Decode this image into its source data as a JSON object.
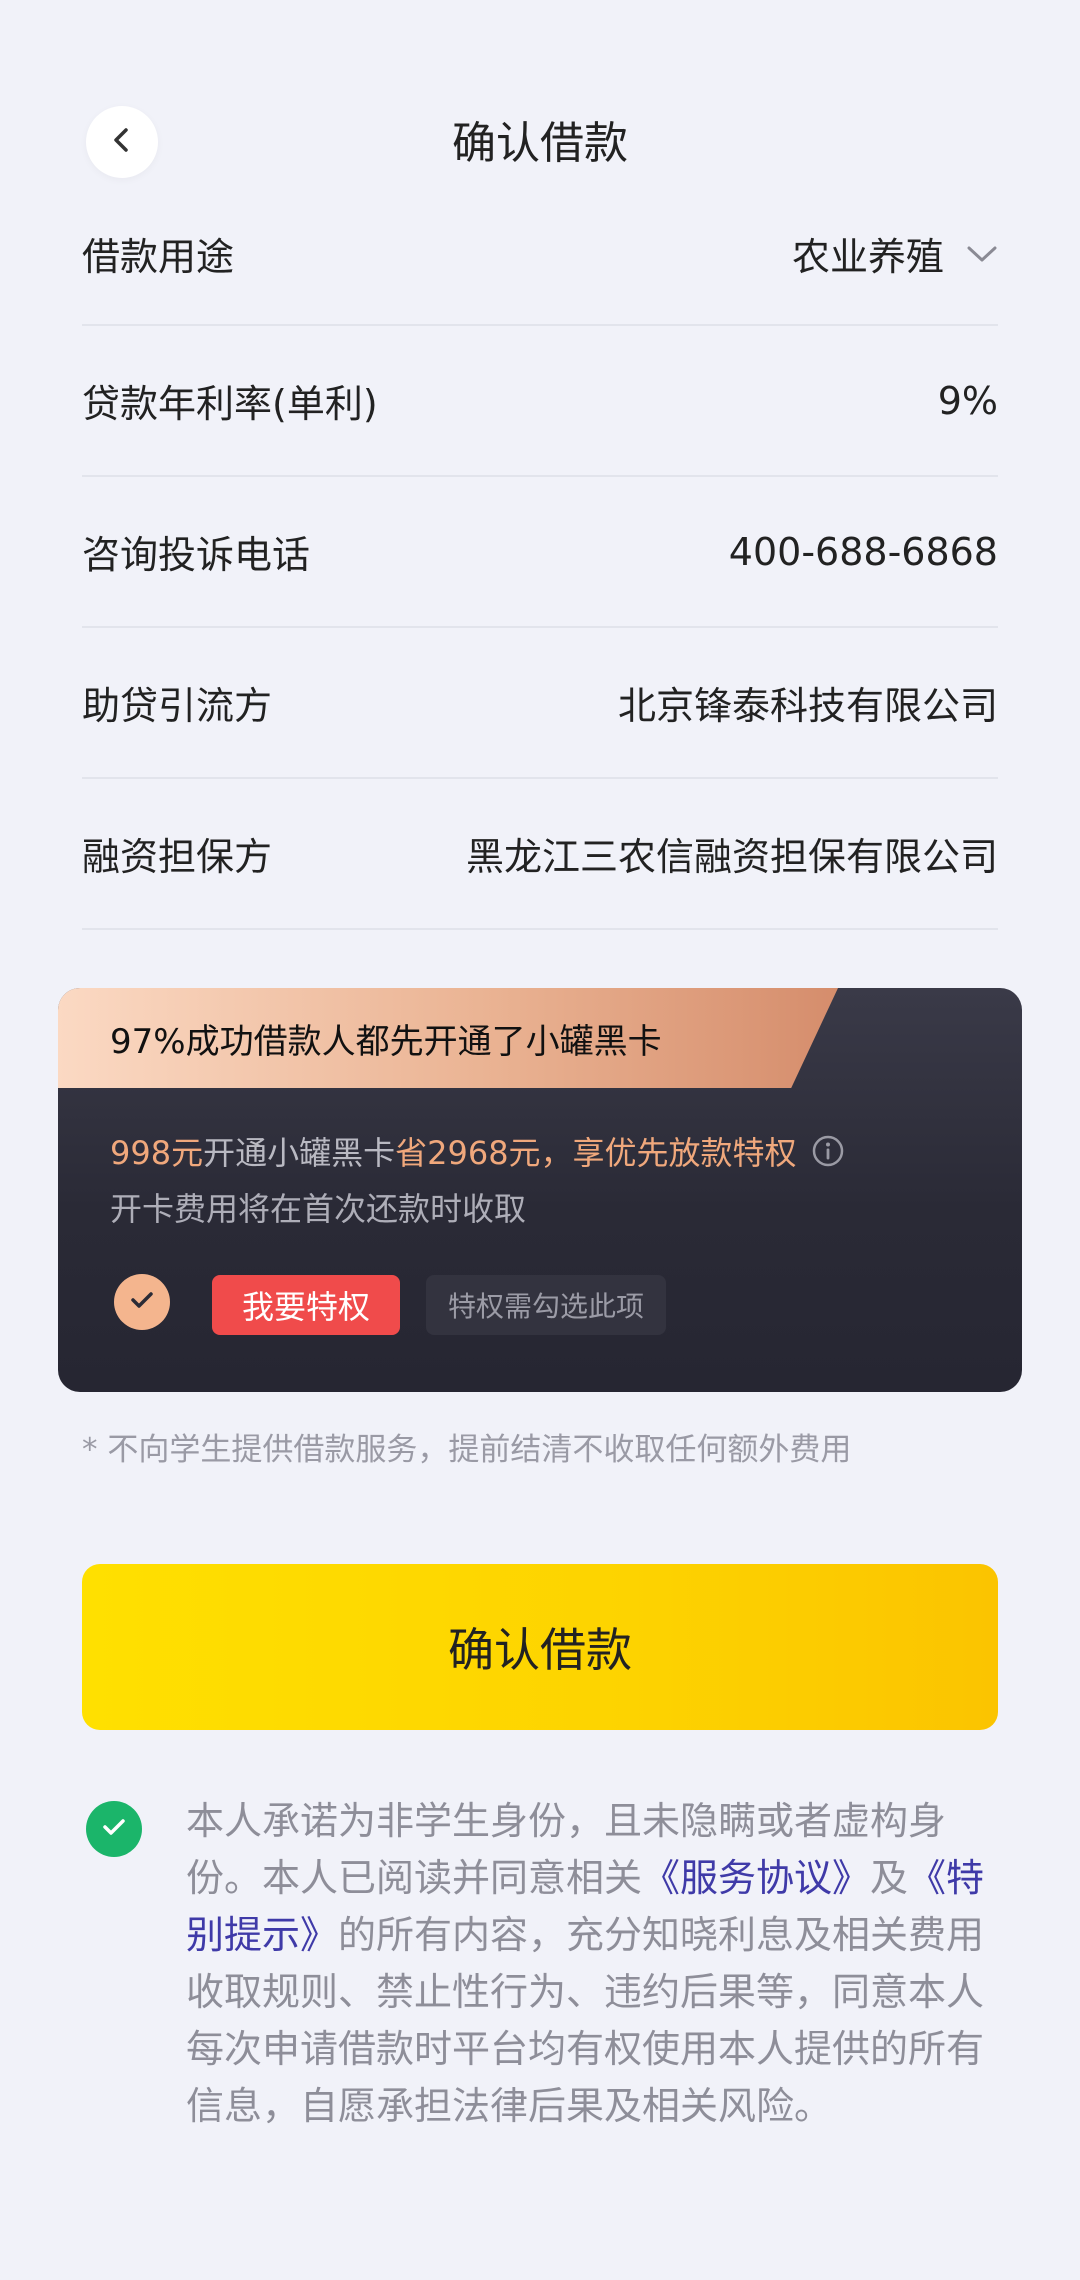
{
  "header": {
    "title": "确认借款"
  },
  "rows": [
    {
      "label": "借款用途",
      "value": "农业养殖"
    },
    {
      "label": "贷款年利率(单利)",
      "value": "9%"
    },
    {
      "label": "咨询投诉电话",
      "value": "400-688-6868"
    },
    {
      "label": "助贷引流方",
      "value": "北京锋泰科技有限公司"
    },
    {
      "label": "融资担保方",
      "value": "黑龙江三农信融资担保有限公司"
    }
  ],
  "promo": {
    "banner": "97%成功借款人都先开通了小罐黑卡",
    "price": "998元",
    "open_text": "开通小罐黑卡",
    "save_text": "省2968元，享优先放款特权",
    "fee_note": "开卡费用将在首次还款时收取",
    "button_label": "我要特权",
    "tip": "特权需勾选此项"
  },
  "note": "* 不向学生提供借款服务，提前结清不收取任何额外费用",
  "confirm_button": "确认借款",
  "agreement": {
    "part1": "本人承诺为非学生身份，且未隐瞒或者虚构身份。本人已阅读并同意相关",
    "link1": "《服务协议》",
    "part2": "及",
    "link2": "《特别提示》",
    "part3": "的所有内容，充分知晓利息及相关费用收取规则、禁止性行为、违约后果等，同意本人每次申请借款时平台均有权使用本人提供的所有信息，自愿承担法律后果及相关风险。"
  },
  "colors": {
    "background": "#f1f2f9",
    "confirm_yellow": "#fdd300",
    "privilege_red": "#f04b4b",
    "accent_orange": "#f0a87c",
    "agree_green": "#1bb56a",
    "link_blue": "#3f3aa8"
  }
}
